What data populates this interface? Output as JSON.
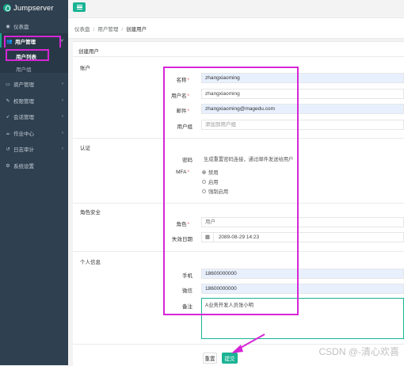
{
  "app": {
    "name": "Jumpserver"
  },
  "sidebar": {
    "items": [
      {
        "label": "仪表盘",
        "icon": "dashboard-icon"
      },
      {
        "label": "用户管理",
        "icon": "users-icon"
      },
      {
        "label": "资产管理",
        "icon": "inbox-icon"
      },
      {
        "label": "权限管理",
        "icon": "edit-icon"
      },
      {
        "label": "会话管理",
        "icon": "rocket-icon"
      },
      {
        "label": "作业中心",
        "icon": "coffee-icon"
      },
      {
        "label": "日志审计",
        "icon": "history-icon"
      },
      {
        "label": "系统设置",
        "icon": "gears-icon"
      }
    ],
    "subitems": [
      {
        "label": "用户列表"
      },
      {
        "label": "用户组"
      }
    ]
  },
  "breadcrumb": [
    "仪表盘",
    "用户管理",
    "创建用户"
  ],
  "panel": {
    "title": "创建用户"
  },
  "sections": {
    "account": "账户",
    "auth": "认证",
    "role": "角色安全",
    "profile": "个人信息"
  },
  "form": {
    "name": {
      "label": "名称",
      "value": "zhangxiaoming"
    },
    "username": {
      "label": "用户名",
      "value": "zhangxiaoming"
    },
    "email": {
      "label": "邮件",
      "value": "zhangxiaoming@magedu.com"
    },
    "groups": {
      "label": "用户组",
      "placeholder": "添加到用户组"
    },
    "password": {
      "label": "密码",
      "hint": "生成重置密码连接，通过邮件发送给用户"
    },
    "mfa": {
      "label": "MFA",
      "options": [
        "禁用",
        "启用",
        "强制启用"
      ],
      "selected": 0
    },
    "role": {
      "label": "角色",
      "value": "用户"
    },
    "expire": {
      "label": "失效日期",
      "value": "2089-08-29 14:23"
    },
    "phone": {
      "label": "手机",
      "value": "18600000000"
    },
    "wechat": {
      "label": "微信",
      "value": "18600000000"
    },
    "comment": {
      "label": "备注",
      "value": "A业务开发人员张小明"
    }
  },
  "buttons": {
    "reset": "重置",
    "submit": "提交"
  },
  "watermark": "CSDN @-清心欢喜",
  "colors": {
    "accent": "#1ab394",
    "sidebar": "#2f4050",
    "annotation": "#d626d6",
    "required": "#ed5565"
  }
}
